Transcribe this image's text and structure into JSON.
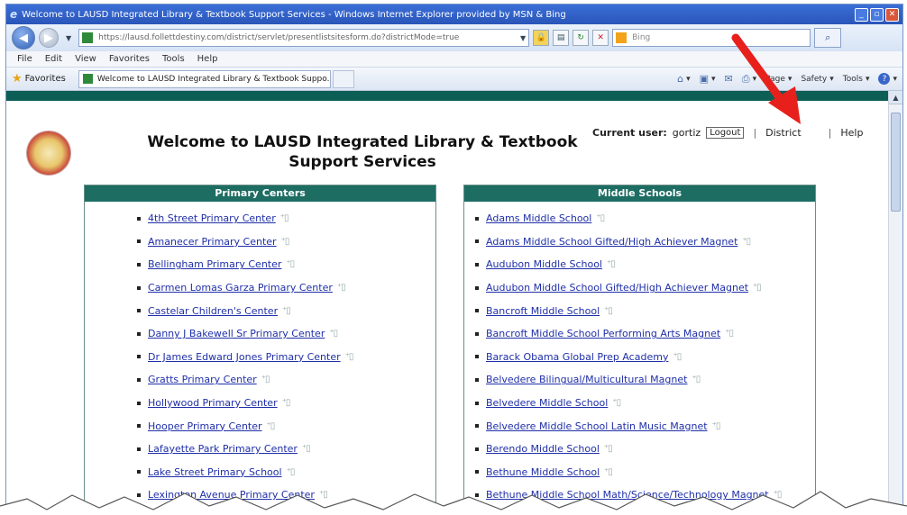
{
  "window": {
    "title": "Welcome to LAUSD Integrated Library & Textbook Support Services - Windows Internet Explorer provided by MSN & Bing",
    "minimize": "_",
    "maximize": "▫",
    "close": "✕"
  },
  "address": {
    "url": "https://lausd.follettdestiny.com/district/servlet/presentlistsitesform.do?districtMode=true",
    "search_placeholder": "Bing"
  },
  "menu": [
    "File",
    "Edit",
    "View",
    "Favorites",
    "Tools",
    "Help"
  ],
  "favorites": {
    "label": "Favorites",
    "tab_title": "Welcome to LAUSD Integrated Library & Textbook Suppo..."
  },
  "command_bar": {
    "page": "Page",
    "safety": "Safety",
    "tools": "Tools"
  },
  "header": {
    "title_line1": "Welcome to LAUSD Integrated Library & Textbook",
    "title_line2": "Support Services",
    "current_user_label": "Current user:",
    "current_user": "gortiz",
    "logout": "Logout",
    "district": "District",
    "help": "Help"
  },
  "primary_centers": {
    "heading": "Primary Centers",
    "items": [
      "4th Street Primary Center",
      "Amanecer Primary Center",
      "Bellingham Primary Center",
      "Carmen Lomas Garza Primary Center",
      "Castelar Children's Center",
      "Danny J Bakewell Sr Primary Center",
      "Dr James Edward Jones Primary Center",
      "Gratts Primary Center",
      "Hollywood Primary Center",
      "Hooper Primary Center",
      "Lafayette Park Primary Center",
      "Lake Street Primary School",
      "Lexington Avenue Primary Center"
    ]
  },
  "middle_schools": {
    "heading": "Middle Schools",
    "items": [
      "Adams Middle School",
      "Adams Middle School Gifted/High Achiever Magnet",
      "Audubon Middle School",
      "Audubon Middle School Gifted/High Achiever Magnet",
      "Bancroft Middle School",
      "Bancroft Middle School Performing Arts Magnet",
      "Barack Obama Global Prep Academy",
      "Belvedere Bilingual/Multicultural Magnet",
      "Belvedere Middle School",
      "Belvedere Middle School Latin Music Magnet",
      "Berendo Middle School",
      "Bethune Middle School",
      "Bethune Middle School Math/Science/Technology Magnet"
    ]
  },
  "colors": {
    "panel_header": "#1d6d63",
    "link": "#1f2fa8",
    "arrow": "#e8201c"
  }
}
